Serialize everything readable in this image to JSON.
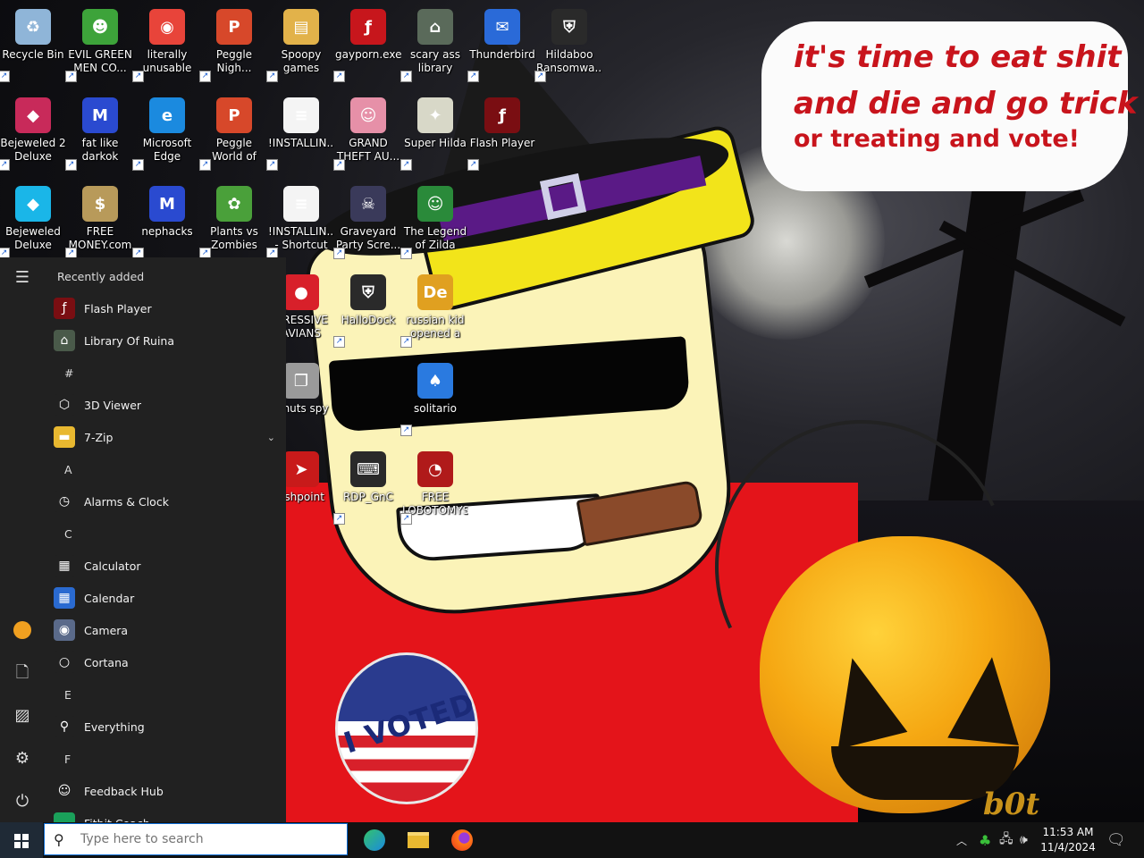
{
  "wallpaper": {
    "bubble_lines": [
      "it's time to eat shit",
      "and die and go trick",
      "or treating and vote!"
    ],
    "pin_text": "I VOTED",
    "watermark": "b0t"
  },
  "desktop_icons": [
    {
      "label": "Recycle Bin",
      "icon": "recycle-bin-icon",
      "color": "#8fb5d8",
      "glyph": "♻"
    },
    {
      "label": "EVIL GREEN MEN CO...",
      "icon": "green-men-icon",
      "color": "#3da33a",
      "glyph": "☻"
    },
    {
      "label": "literally unusable",
      "icon": "chrome-icon",
      "color": "#e8443a",
      "glyph": "◉"
    },
    {
      "label": "Peggle Nigh...",
      "icon": "peggle-icon",
      "color": "#d7482a",
      "glyph": "P"
    },
    {
      "label": "Spoopy games",
      "icon": "folder-icon",
      "color": "#e2b24a",
      "glyph": "▤"
    },
    {
      "label": "gayporn.exe",
      "icon": "flash-icon",
      "color": "#c7161c",
      "glyph": "ƒ"
    },
    {
      "label": "scary ass library",
      "icon": "library-icon",
      "color": "#5a6a5a",
      "glyph": "⌂"
    },
    {
      "label": "Thunderbird",
      "icon": "thunderbird-icon",
      "color": "#2a6ad8",
      "glyph": "✉"
    },
    {
      "label": "Hildaboo Ransomwa...",
      "icon": "shield-icon",
      "color": "#2a2a2a",
      "glyph": "⛨"
    },
    {
      "label": "Bejeweled 2 Deluxe",
      "icon": "bejeweled-icon",
      "color": "#c82a5a",
      "glyph": "◆"
    },
    {
      "label": "fat like darkok",
      "icon": "mpi-icon",
      "color": "#2a4ad0",
      "glyph": "M"
    },
    {
      "label": "Microsoft Edge",
      "icon": "edge-icon",
      "color": "#1b8adf",
      "glyph": "e"
    },
    {
      "label": "Peggle World of Warcraft ...",
      "icon": "peggle-wow-icon",
      "color": "#d7482a",
      "glyph": "P"
    },
    {
      "label": "!INSTALLIN...",
      "icon": "document-icon",
      "color": "#f4f4f4",
      "glyph": "≡"
    },
    {
      "label": "GRAND THEFT AU...",
      "icon": "gta-icon",
      "color": "#e690a8",
      "glyph": "☺"
    },
    {
      "label": "Super Hilda",
      "icon": "super-hilda-icon",
      "color": "#d8d8c8",
      "glyph": "✦"
    },
    {
      "label": "Flash Player",
      "icon": "flash-player-icon",
      "color": "#7a0e12",
      "glyph": "ƒ"
    },
    {
      "label": "Bejeweled Deluxe",
      "icon": "bejeweled-deluxe-icon",
      "color": "#1ab6e8",
      "glyph": "◆"
    },
    {
      "label": "FREE MONEY.com",
      "icon": "money-bag-icon",
      "color": "#b89a5a",
      "glyph": "$"
    },
    {
      "label": "nephacks",
      "icon": "nephacks-icon",
      "color": "#2a4ad0",
      "glyph": "M"
    },
    {
      "label": "Plants vs Zombies",
      "icon": "plants-vs-zombies-icon",
      "color": "#4aa03a",
      "glyph": "✿"
    },
    {
      "label": "!INSTALLIN... - Shortcut",
      "icon": "document-shortcut-icon",
      "color": "#f4f4f4",
      "glyph": "≡"
    },
    {
      "label": "Graveyard Party Scre...",
      "icon": "graveyard-icon",
      "color": "#3a3a5a",
      "glyph": "☠"
    },
    {
      "label": "The Legend of Zilda",
      "icon": "zilda-icon",
      "color": "#2a8a3a",
      "glyph": "☺"
    },
    {
      "label": "GRESSIVE AVIANS",
      "icon": "angry-birds-icon",
      "color": "#d8202a",
      "glyph": "●"
    },
    {
      "label": "HalloDock",
      "icon": "windows-shield-icon",
      "color": "#2a2a2a",
      "glyph": "⛨"
    },
    {
      "label": "russian kid opened a rat",
      "icon": "de-icon",
      "color": "#e0a020",
      "glyph": "De"
    },
    {
      "label": "z nuts spy",
      "icon": "copy-icon",
      "color": "#9a9a9a",
      "glyph": "❐"
    },
    {
      "label": "solitario",
      "icon": "solitario-icon",
      "color": "#2a7ae0",
      "glyph": "♠"
    },
    {
      "label": "ashpoint",
      "icon": "ashpoint-icon",
      "color": "#c81a1a",
      "glyph": "➤"
    },
    {
      "label": "RDP_GnC",
      "icon": "rdp-icon",
      "color": "#2a2a2a",
      "glyph": "⌨"
    },
    {
      "label": "FREE LOBOTOMYS",
      "icon": "lobotomy-icon",
      "color": "#b01a1a",
      "glyph": "◔"
    }
  ],
  "start_menu": {
    "recently_added_header": "Recently added",
    "recent": [
      {
        "label": "Flash Player",
        "icon": "flash-player-icon",
        "color": "#7a0e12",
        "glyph": "ƒ"
      },
      {
        "label": "Library Of Ruina",
        "icon": "library-of-ruina-icon",
        "color": "#4a5a4a",
        "glyph": "⌂"
      }
    ],
    "sections": [
      {
        "letter": "#",
        "apps": [
          {
            "label": "3D Viewer",
            "icon": "cube-icon",
            "color": "#212121",
            "glyph": "⬡"
          },
          {
            "label": "7-Zip",
            "icon": "folder-icon",
            "color": "#e8b830",
            "glyph": "▬",
            "expandable": true
          }
        ]
      },
      {
        "letter": "A",
        "apps": [
          {
            "label": "Alarms & Clock",
            "icon": "clock-icon",
            "color": "#212121",
            "glyph": "◷"
          }
        ]
      },
      {
        "letter": "C",
        "apps": [
          {
            "label": "Calculator",
            "icon": "calculator-icon",
            "color": "#212121",
            "glyph": "▦"
          },
          {
            "label": "Calendar",
            "icon": "calendar-icon",
            "color": "#2a6ad0",
            "glyph": "▦"
          },
          {
            "label": "Camera",
            "icon": "camera-icon",
            "color": "#5a6a8a",
            "glyph": "◉"
          },
          {
            "label": "Cortana",
            "icon": "cortana-icon",
            "color": "#212121",
            "glyph": "○"
          }
        ]
      },
      {
        "letter": "E",
        "apps": [
          {
            "label": "Everything",
            "icon": "everything-search-icon",
            "color": "#212121",
            "glyph": "⚲"
          }
        ]
      },
      {
        "letter": "F",
        "apps": [
          {
            "label": "Feedback Hub",
            "icon": "feedback-hub-icon",
            "color": "#212121",
            "glyph": "☺"
          }
        ]
      }
    ],
    "partial_app": "Fitbit Coach"
  },
  "taskbar": {
    "search_placeholder": "Type here to search",
    "time": "11:53 AM",
    "date": "11/4/2024"
  }
}
